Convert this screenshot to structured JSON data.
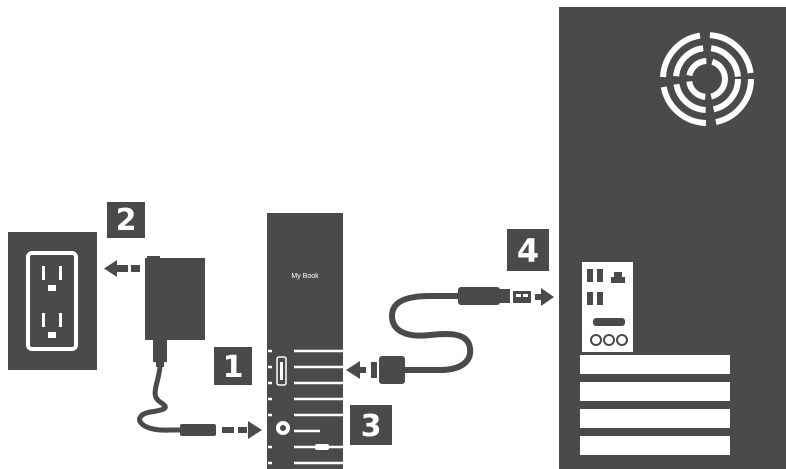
{
  "colors": {
    "dark": "#4a4a4c",
    "cable": "#4a4a4c",
    "background": "#ffffff",
    "mark": "#ffffff"
  },
  "drive": {
    "label": "My Book"
  },
  "steps": [
    {
      "id": "step-1",
      "number": "1"
    },
    {
      "id": "step-2",
      "number": "2"
    },
    {
      "id": "step-3",
      "number": "3"
    },
    {
      "id": "step-4",
      "number": "4"
    }
  ],
  "icons": {
    "wall_outlet": "wall-outlet-icon",
    "power_adapter": "power-adapter-icon",
    "usb_cable": "usb-cable-icon",
    "computer_tower": "computer-tower-icon",
    "fan": "fan-icon"
  }
}
